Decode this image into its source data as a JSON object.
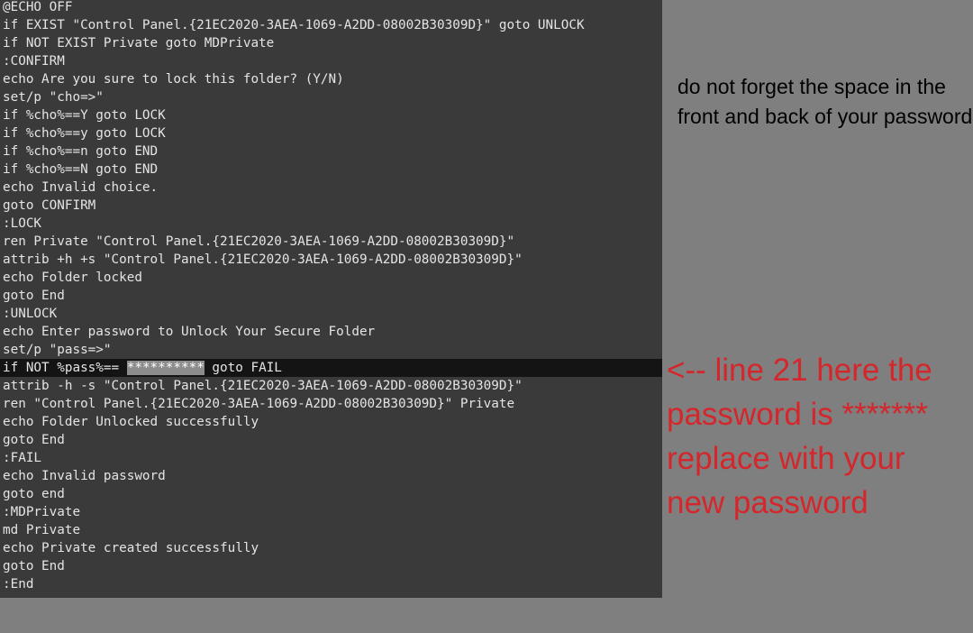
{
  "editor": {
    "lines": [
      "@ECHO OFF",
      "if EXIST \"Control Panel.{21EC2020-3AEA-1069-A2DD-08002B30309D}\" goto UNLOCK",
      "if NOT EXIST Private goto MDPrivate",
      ":CONFIRM",
      "echo Are you sure to lock this folder? (Y/N)",
      "set/p \"cho=>\"",
      "if %cho%==Y goto LOCK",
      "if %cho%==y goto LOCK",
      "if %cho%==n goto END",
      "if %cho%==N goto END",
      "echo Invalid choice.",
      "goto CONFIRM",
      ":LOCK",
      "ren Private \"Control Panel.{21EC2020-3AEA-1069-A2DD-08002B30309D}\"",
      "attrib +h +s \"Control Panel.{21EC2020-3AEA-1069-A2DD-08002B30309D}\"",
      "echo Folder locked",
      "goto End",
      ":UNLOCK",
      "echo Enter password to Unlock Your Secure Folder",
      "set/p \"pass=>\"",
      "",
      "attrib -h -s \"Control Panel.{21EC2020-3AEA-1069-A2DD-08002B30309D}\"",
      "ren \"Control Panel.{21EC2020-3AEA-1069-A2DD-08002B30309D}\" Private",
      "echo Folder Unlocked successfully",
      "goto End",
      ":FAIL",
      "echo Invalid password",
      "goto end",
      ":MDPrivate",
      "md Private",
      "echo Private created successfully",
      "goto End",
      ":End"
    ],
    "highlighted_line": {
      "before": "if NOT %pass%== ",
      "selection": "**********",
      "after": " goto FAIL"
    }
  },
  "notes": {
    "space_note": "do not forget the space in the front and back of your password",
    "password_note": "<-- line 21 here the\npassword is *******\nreplace with your\nnew password"
  },
  "colors": {
    "editor_bg": "#3a3a3a",
    "highlight_bg": "#141414",
    "selection_bg": "#8c8c8c",
    "page_bg": "#7f7f7f",
    "annotation_red": "#d4262b"
  }
}
